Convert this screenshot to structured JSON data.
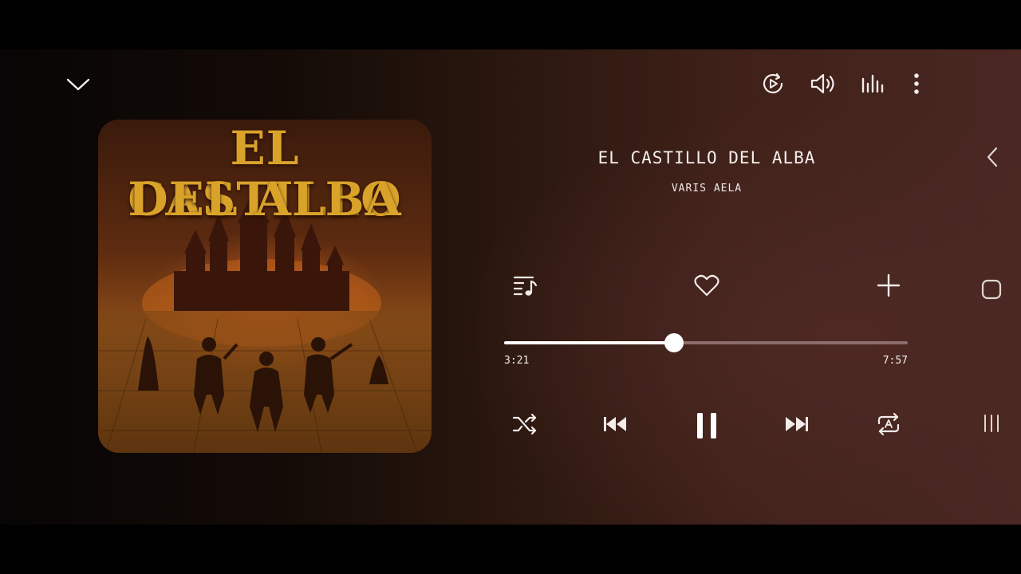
{
  "track": {
    "title": "EL CASTILLO DEL ALBA",
    "artist": "VARIS AELA"
  },
  "album_art": {
    "title_line1": "EL CASTILLO",
    "title_line2": "DEL ALBA"
  },
  "progress": {
    "elapsed": "3:21",
    "total": "7:57",
    "fraction": 0.42
  },
  "icons": {
    "collapse": "chevron-down-icon",
    "video": "play-video-icon",
    "volume": "volume-icon",
    "equalizer": "equalizer-icon",
    "more": "more-vertical-icon",
    "back": "chevron-left-icon",
    "queue": "queue-music-icon",
    "like": "heart-icon",
    "add": "plus-icon",
    "shuffle": "shuffle-icon",
    "previous": "skip-previous-icon",
    "pause": "pause-icon",
    "next": "skip-next-icon",
    "repeat": "repeat-all-icon",
    "nav_home": "nav-home-icon",
    "nav_recents": "nav-recents-icon"
  },
  "colors": {
    "art_title": "#d9a32a",
    "progress_fill": "#ffffff",
    "progress_track": "#8c6d6b"
  }
}
